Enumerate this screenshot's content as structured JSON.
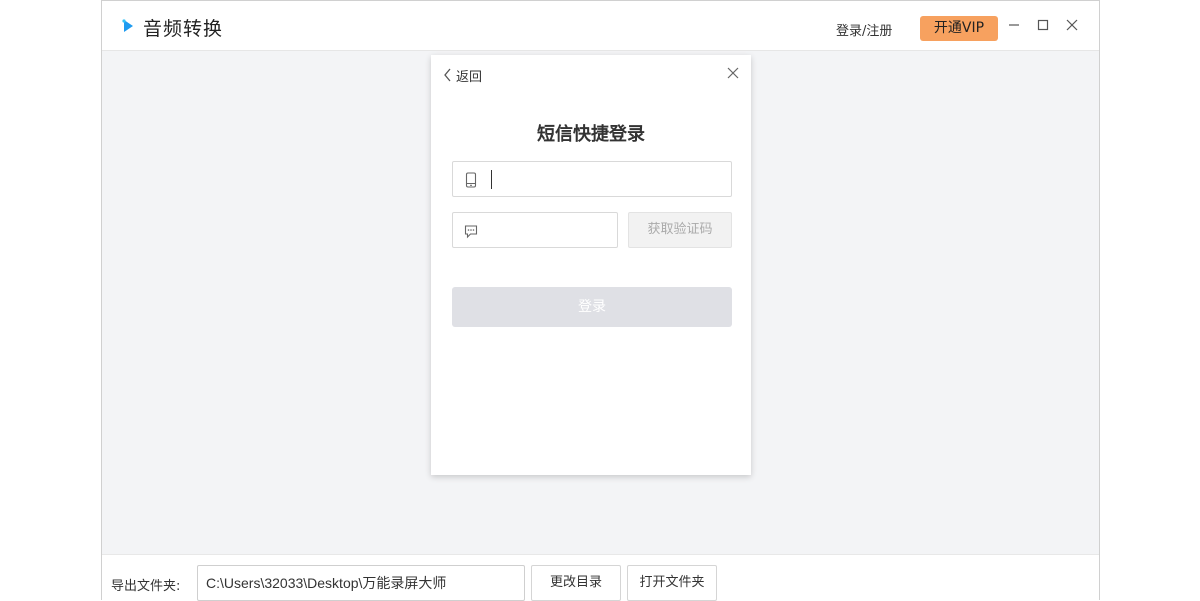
{
  "app": {
    "title": "音频转换",
    "accent_color": "#1e9bf0"
  },
  "header": {
    "login_register": "登录/注册",
    "vip_button": "开通VIP",
    "vip_color": "#f7a15f"
  },
  "dialog": {
    "back_label": "返回",
    "title": "短信快捷登录",
    "phone_input": {
      "value": "",
      "placeholder": ""
    },
    "code_input": {
      "value": "",
      "placeholder": ""
    },
    "get_code_button": "获取验证码",
    "submit_button": "登录",
    "icons": {
      "back": "chevron-left-icon",
      "close": "close-icon",
      "phone": "phone-icon",
      "message": "message-icon"
    }
  },
  "footer": {
    "export_label": "导出文件夹:",
    "path_value": "C:\\Users\\32033\\Desktop\\万能录屏大师",
    "change_dir_button": "更改目录",
    "open_folder_button": "打开文件夹"
  }
}
